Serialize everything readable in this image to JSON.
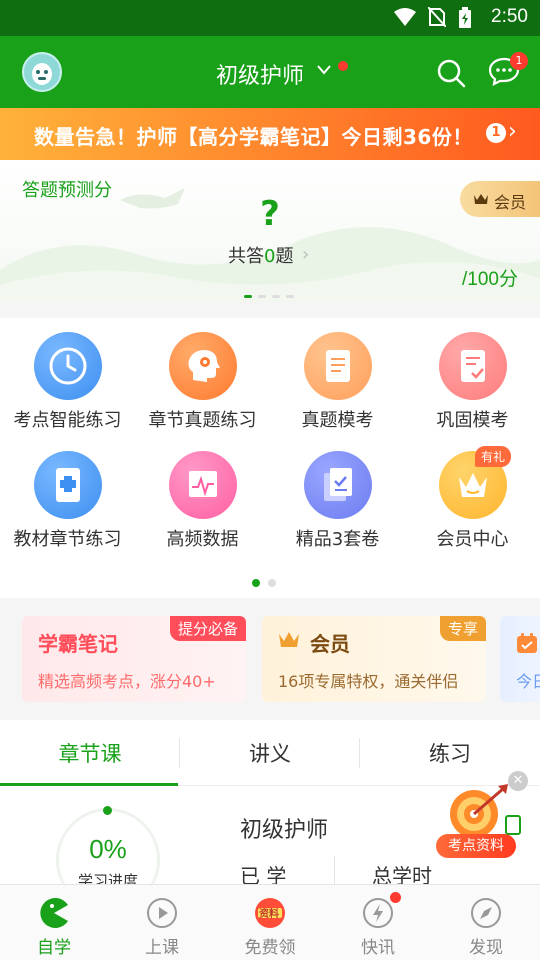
{
  "status_bar": {
    "time": "2:50"
  },
  "header": {
    "title": "初级护师",
    "message_badge": "1"
  },
  "banner": {
    "text": "数量告急！护师【高分学霸笔记】今日剩36份！",
    "badge": "1"
  },
  "prediction": {
    "title": "答题预测分",
    "question_mark": "?",
    "answered_prefix": "共答",
    "answered_count": "0",
    "answered_suffix": "题",
    "score": "/100分",
    "vip_label": "会员"
  },
  "grid": {
    "items": [
      {
        "label": "考点智能练习",
        "icon": "clock-icon",
        "color": "#3d8ff0"
      },
      {
        "label": "章节真题练习",
        "icon": "head-gear-icon",
        "color": "#ff7a2f"
      },
      {
        "label": "真题模考",
        "icon": "document-icon",
        "color": "#ff9f5a"
      },
      {
        "label": "巩固模考",
        "icon": "checklist-icon",
        "color": "#ff7b7b"
      },
      {
        "label": "教材章节练习",
        "icon": "book-icon",
        "color": "#3d8ff0"
      },
      {
        "label": "高频数据",
        "icon": "chart-icon",
        "color": "#ff5fa2"
      },
      {
        "label": "精品3套卷",
        "icon": "papers-icon",
        "color": "#6b7cf0"
      },
      {
        "label": "会员中心",
        "icon": "crown-icon",
        "color": "#ffb52e"
      }
    ],
    "gift_tag": "有礼",
    "page_count": 2,
    "current_page": 1
  },
  "promos": [
    {
      "title": "学霸笔记",
      "subtitle": "精选高频考点，涨分40+",
      "tag": "提分必备",
      "color": "#ff4d5a"
    },
    {
      "title": "会员",
      "subtitle": "16项专属特权，通关伴侣",
      "tag": "专享",
      "color": "#f0a030"
    },
    {
      "title": "",
      "subtitle": "今日",
      "tag": "",
      "color": "#6b9cf0"
    }
  ],
  "tabs": [
    {
      "label": "章节课",
      "active": true
    },
    {
      "label": "讲义",
      "active": false
    },
    {
      "label": "练习",
      "active": false
    }
  ],
  "course": {
    "progress": "0%",
    "progress_label": "学习进度",
    "title": "初级护师",
    "learned_label": "已 学",
    "total_hours_label": "总学时",
    "float_label": "考点资料"
  },
  "bottom_nav": [
    {
      "label": "自学",
      "icon": "pacman-icon",
      "active": true
    },
    {
      "label": "上课",
      "icon": "play-icon",
      "active": false
    },
    {
      "label": "免费领",
      "icon": "gift-badge-icon",
      "badge": "资料",
      "active": false
    },
    {
      "label": "快讯",
      "icon": "lightning-icon",
      "active": false,
      "dot": true
    },
    {
      "label": "发现",
      "icon": "compass-icon",
      "active": false
    }
  ],
  "colors": {
    "brand": "#1aa11a",
    "status_bar": "#0f6e0f",
    "alert": "#ff3b30"
  }
}
